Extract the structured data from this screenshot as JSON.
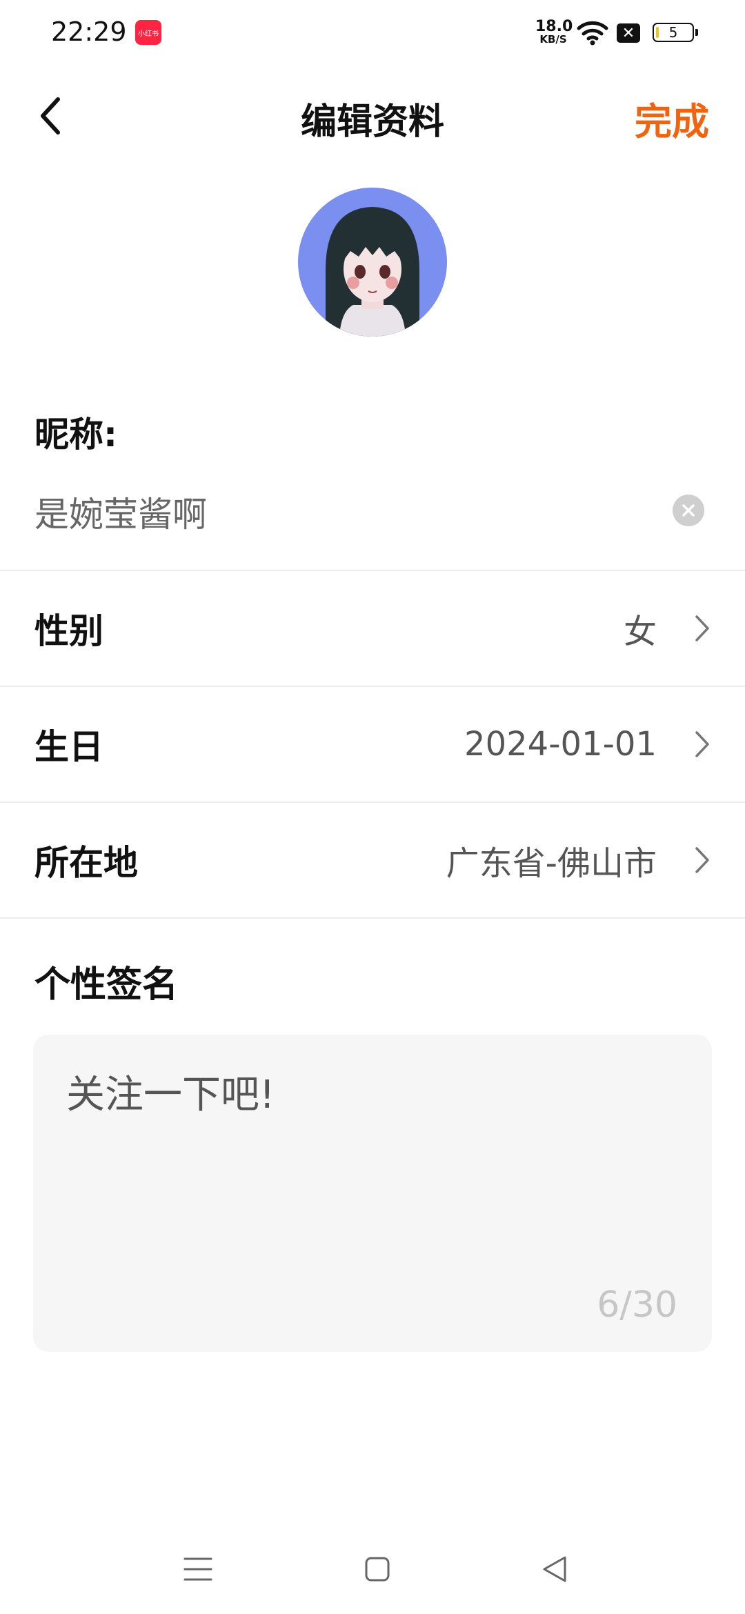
{
  "status_bar": {
    "time": "22:29",
    "app_badge": "小红书",
    "net_speed_value": "18.0",
    "net_speed_unit": "KB/S",
    "battery_level": "5",
    "icons": [
      "wifi-icon",
      "close-icon",
      "battery-icon"
    ]
  },
  "header": {
    "title": "编辑资料",
    "done_label": "完成",
    "back_icon": "chevron-left-icon"
  },
  "colors": {
    "accent": "#f0640f",
    "app_brand": "#ff2442",
    "avatar_bg": "#7b8ff0"
  },
  "profile": {
    "avatar_icon": "avatar-icon",
    "nickname_label": "昵称:",
    "nickname_value": "是婉莹酱啊",
    "fields": [
      {
        "label": "性别",
        "value": "女"
      },
      {
        "label": "生日",
        "value": "2024-01-01"
      },
      {
        "label": "所在地",
        "value": "广东省-佛山市"
      }
    ],
    "signature_label": "个性签名",
    "signature_text": "关注一下吧!",
    "signature_counter": "6/30"
  },
  "nav_bar": {
    "icons": [
      "menu-icon",
      "home-icon",
      "back-triangle-icon"
    ]
  }
}
